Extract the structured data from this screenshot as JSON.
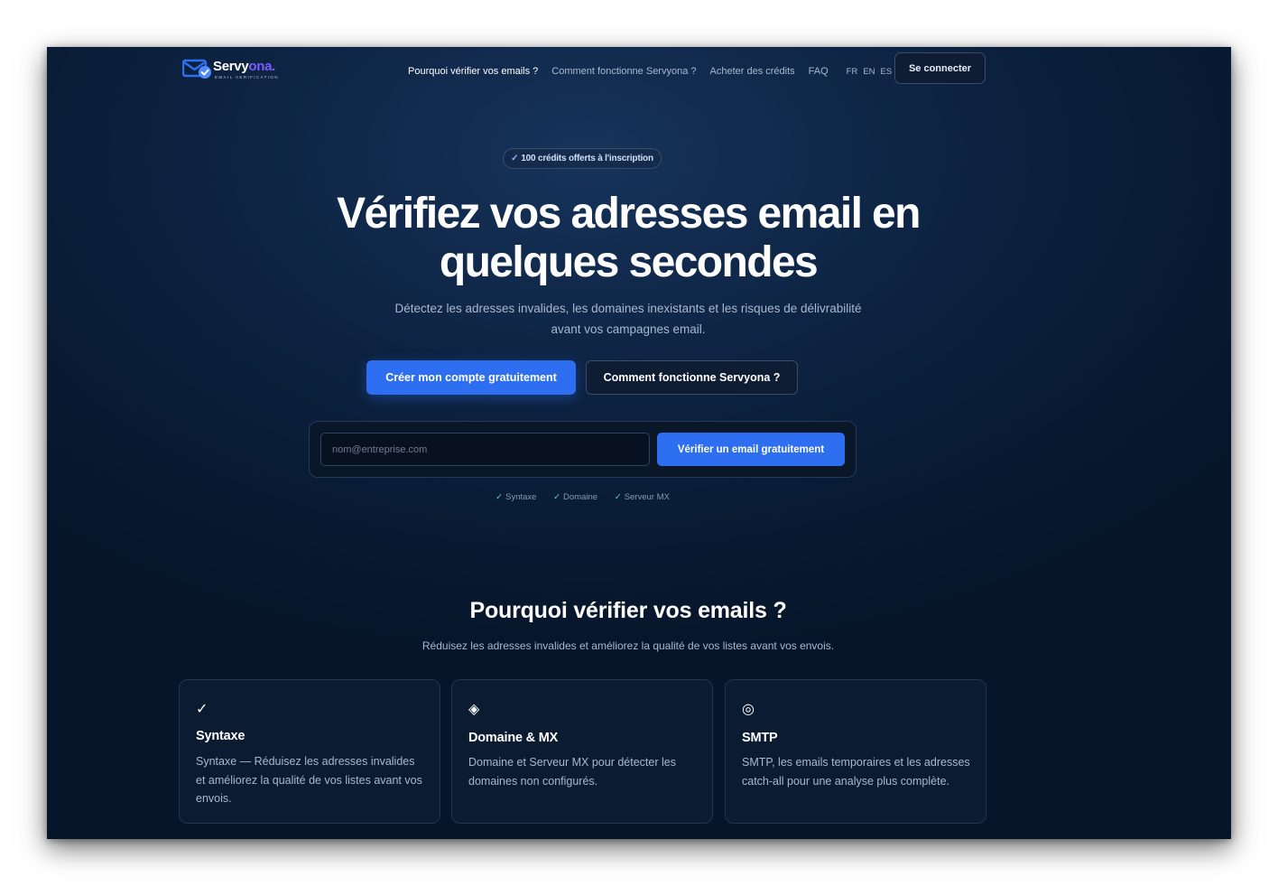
{
  "brand": {
    "name_part1": "Servy",
    "name_part2": "ona.",
    "tagline": "EMAIL VERIFICATION",
    "colors": {
      "blue": "#2d6ff0",
      "violet": "#7c5cff",
      "check": "#4f8bff"
    }
  },
  "nav": {
    "items": [
      {
        "label": "Pourquoi vérifier vos emails ?",
        "active": true
      },
      {
        "label": "Comment fonctionne Servyona ?",
        "active": false
      },
      {
        "label": "Acheter des crédits",
        "active": false
      },
      {
        "label": "FAQ",
        "active": false
      }
    ],
    "languages": [
      "FR",
      "EN",
      "ES"
    ],
    "login_label": "Se connecter"
  },
  "hero": {
    "badge_icon": "✓",
    "badge_text": "100 crédits offerts à l'inscription",
    "title_line1": "Vérifiez vos adresses email en",
    "title_line2": "quelques secondes",
    "subtitle_line1": "Détectez les adresses invalides, les domaines inexistants et les risques de délivrabilité",
    "subtitle_line2": "avant vos campagnes email.",
    "primary_cta": "Créer mon compte gratuitement",
    "secondary_cta": "Comment fonctionne Servyona ?"
  },
  "verify": {
    "value": "",
    "placeholder": "nom@entreprise.com",
    "button_label": "Vérifier un email gratuitement",
    "checks": [
      {
        "icon": "✓",
        "label": "Syntaxe"
      },
      {
        "icon": "✓",
        "label": "Domaine"
      },
      {
        "icon": "✓",
        "label": "Serveur MX"
      }
    ]
  },
  "section": {
    "title": "Pourquoi vérifier vos emails ?",
    "subtitle": "Réduisez les adresses invalides et améliorez la qualité de vos listes avant vos envois.",
    "cards": [
      {
        "icon": "✓",
        "icon_name": "check-icon",
        "title": "Syntaxe",
        "text": "Syntaxe — Réduisez les adresses invalides et améliorez la qualité de vos listes avant vos envois."
      },
      {
        "icon": "◈",
        "icon_name": "diamond-icon",
        "title": "Domaine & MX",
        "text": "Domaine et Serveur MX pour détecter les domaines non configurés."
      },
      {
        "icon": "◎",
        "icon_name": "target-icon",
        "title": "SMTP",
        "text": "SMTP, les emails temporaires et les adresses catch-all pour une analyse plus complète."
      }
    ]
  }
}
